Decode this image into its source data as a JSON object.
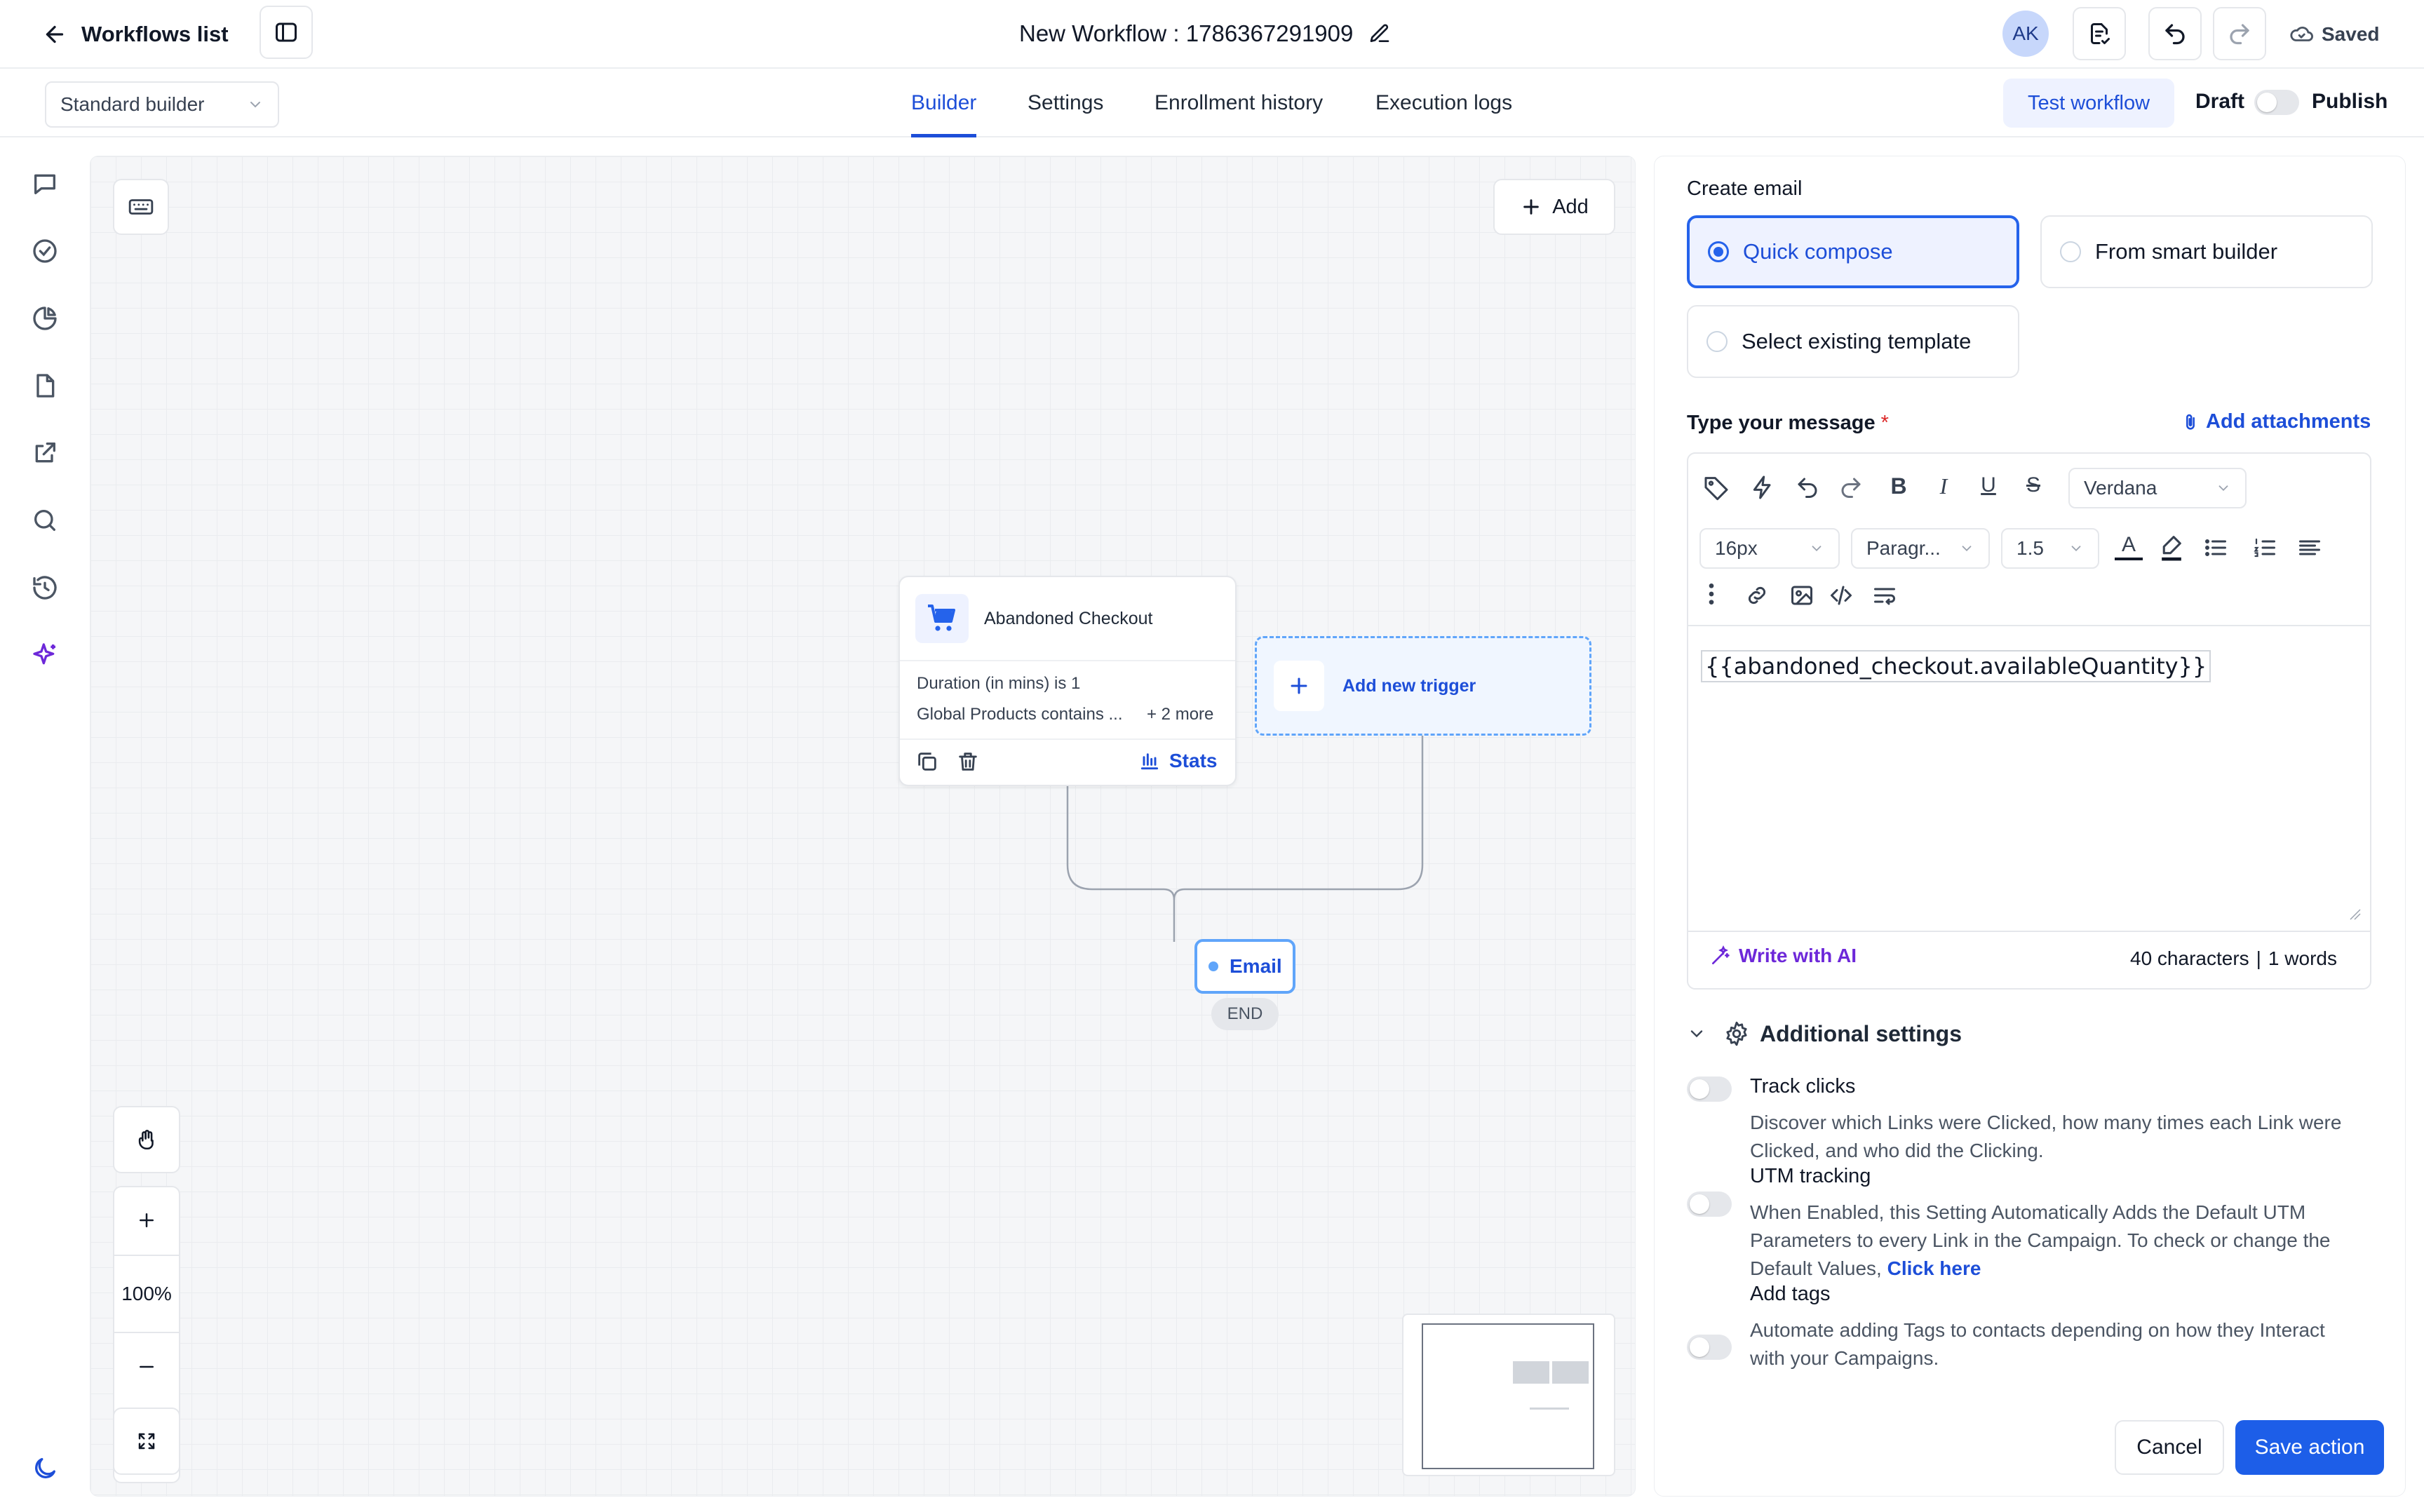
{
  "header": {
    "back_label": "Workflows list",
    "title": "New Workflow : 1786367291909",
    "avatar": "AK",
    "saved_label": "Saved"
  },
  "subbar": {
    "builder_select": "Standard builder",
    "tabs": [
      "Builder",
      "Settings",
      "Enrollment history",
      "Execution logs"
    ],
    "active_tab": "Builder",
    "test_label": "Test workflow",
    "draft_label": "Draft",
    "publish_label": "Publish"
  },
  "canvas": {
    "add_label": "Add",
    "trigger": {
      "title": "Abandoned Checkout",
      "line1": "Duration (in mins) is 1",
      "line2": "Global Products contains ...",
      "more": "+ 2 more",
      "stats": "Stats"
    },
    "add_trigger_label": "Add new trigger",
    "email_node": "Email",
    "end_label": "END",
    "zoom": "100%"
  },
  "panel": {
    "create_email_label": "Create email",
    "options": [
      "Quick compose",
      "From smart builder",
      "Select existing template"
    ],
    "selected_option": "Quick compose",
    "message_label": "Type your message",
    "required_mark": "*",
    "attachments_label": "Add attachments",
    "font_family": "Verdana",
    "font_size": "16px",
    "block_type": "Paragr...",
    "line_height": "1.5",
    "editor_content": "{{abandoned_checkout.availableQuantity}}",
    "write_ai": "Write with AI",
    "char_count": "40 characters",
    "word_count": "1 words",
    "additional_settings": "Additional settings",
    "settings": [
      {
        "title": "Track clicks",
        "desc": "Discover which Links were Clicked, how many times each Link were Clicked, and who did the Clicking."
      },
      {
        "title": "UTM tracking",
        "desc": "When Enabled, this Setting Automatically Adds the Default UTM Parameters to every Link in the Campaign. To check or change the Default Values,",
        "link": "Click here"
      },
      {
        "title": "Add tags",
        "desc": "Automate adding Tags to contacts depending on how they Interact with your Campaigns."
      }
    ],
    "cancel_label": "Cancel",
    "save_label": "Save action"
  },
  "colors": {
    "accent": "#1d5ee8",
    "selected_bg": "#eef2ff",
    "ai_purple": "#6d28d9"
  }
}
